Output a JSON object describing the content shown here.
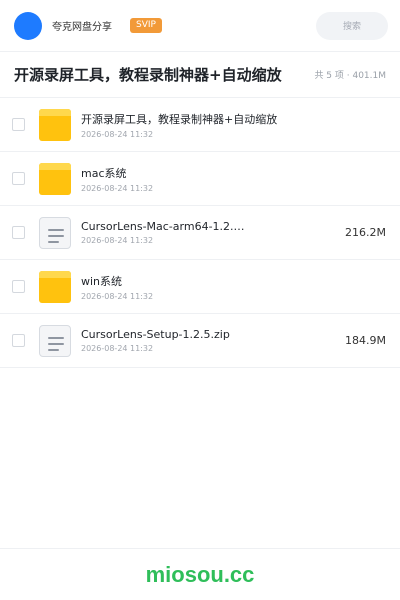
{
  "header": {
    "brand": "夸克网盘分享",
    "badge": "SVIP",
    "search_placeholder": "搜索",
    "accent": "#1e7bff",
    "badge_color": "#f29a38"
  },
  "folder": {
    "title": "开源录屏工具，教程录制神器+自动缩放",
    "meta": "共 5 项 · 401.1M"
  },
  "items": [
    {
      "name": "开源录屏工具，教程录制神器+自动缩放",
      "date": "2026-08-24 11:32",
      "size": "",
      "icon": "folder-icon"
    },
    {
      "name": "mac系统",
      "date": "2026-08-24 11:32",
      "size": "",
      "icon": "folder-icon"
    },
    {
      "name": "CursorLens-Mac-arm64-1.2.…",
      "date": "2026-08-24 11:32",
      "size": "216.2M",
      "icon": "file-icon"
    },
    {
      "name": "win系统",
      "date": "2026-08-24 11:32",
      "size": "",
      "icon": "folder-icon"
    },
    {
      "name": "CursorLens-Setup-1.2.5.zip",
      "date": "2026-08-24 11:32",
      "size": "184.9M",
      "icon": "file-icon"
    }
  ],
  "footer": {
    "brand": "miosou.cc",
    "brand_color": "#2fbe5a"
  }
}
